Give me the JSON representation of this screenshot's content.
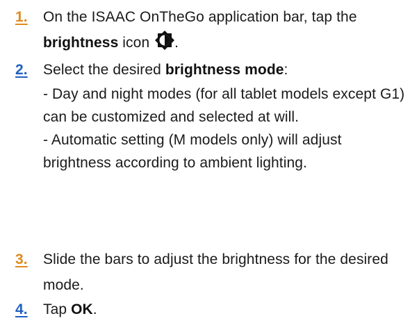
{
  "steps": [
    {
      "number": "1.",
      "text_a": "On the ISAAC OnTheGo application bar, tap the ",
      "bold": "brightness",
      "text_b": " icon ",
      "icon": "brightness-icon",
      "text_c": "."
    },
    {
      "number": "2.",
      "text_a": "Select the desired ",
      "bold": "brightness mode",
      "text_b": ":",
      "sub_a": "- Day and night modes (for all tablet models except G1) can be customized and selected at will.",
      "sub_b": "- Automatic setting (M models only) will adjust brightness according to ambient lighting."
    },
    {
      "number": "3.",
      "text_a": "Slide the bars to adjust the brightness for the desired mode."
    },
    {
      "number": "4.",
      "text_a": "Tap ",
      "bold": "OK",
      "text_b": "."
    }
  ],
  "colors": {
    "number_blue": "#1f5fbf",
    "number_orange": "#e08a1e"
  }
}
